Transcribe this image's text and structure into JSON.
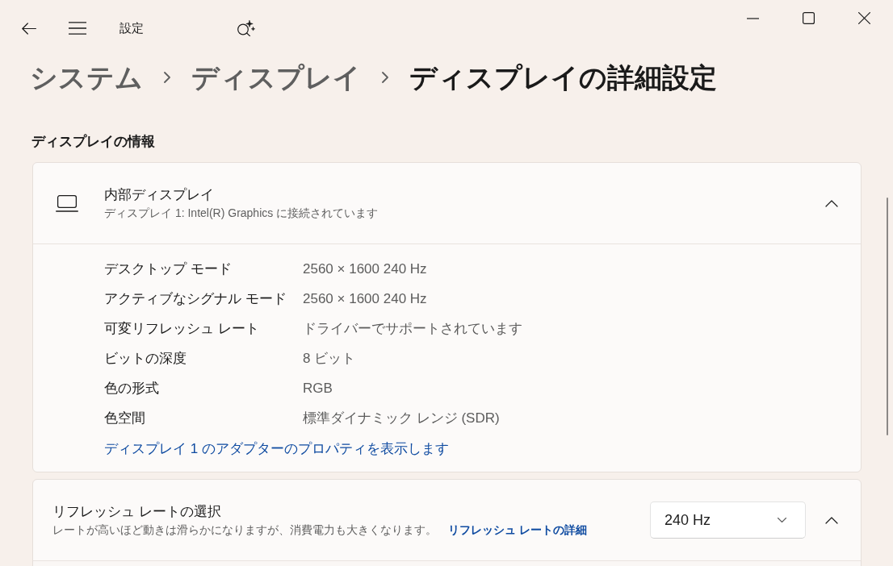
{
  "window": {
    "title": "設定"
  },
  "breadcrumb": [
    {
      "label": "システム",
      "current": false
    },
    {
      "label": "ディスプレイ",
      "current": false
    },
    {
      "label": "ディスプレイの詳細設定",
      "current": true
    }
  ],
  "section_title": "ディスプレイの情報",
  "display_card": {
    "title": "内部ディスプレイ",
    "subtitle": "ディスプレイ 1: Intel(R) Graphics に接続されています",
    "expanded": true,
    "properties": [
      {
        "label": "デスクトップ モード",
        "value": "2560 × 1600 240 Hz"
      },
      {
        "label": "アクティブなシグナル モード",
        "value": "2560 × 1600 240 Hz"
      },
      {
        "label": "可変リフレッシュ レート",
        "value": "ドライバーでサポートされています"
      },
      {
        "label": "ビットの深度",
        "value": "8 ビット"
      },
      {
        "label": "色の形式",
        "value": "RGB"
      },
      {
        "label": "色空間",
        "value": "標準ダイナミック レンジ (SDR)"
      }
    ],
    "link": "ディスプレイ 1 のアダプターのプロパティを表示します"
  },
  "refresh_card": {
    "title": "リフレッシュ レートの選択",
    "description": "レートが高いほど動きは滑らかになりますが、消費電力も大きくなります。",
    "link": "リフレッシュ レートの詳細",
    "dropdown": {
      "value": "240 Hz"
    },
    "expanded": true
  }
}
